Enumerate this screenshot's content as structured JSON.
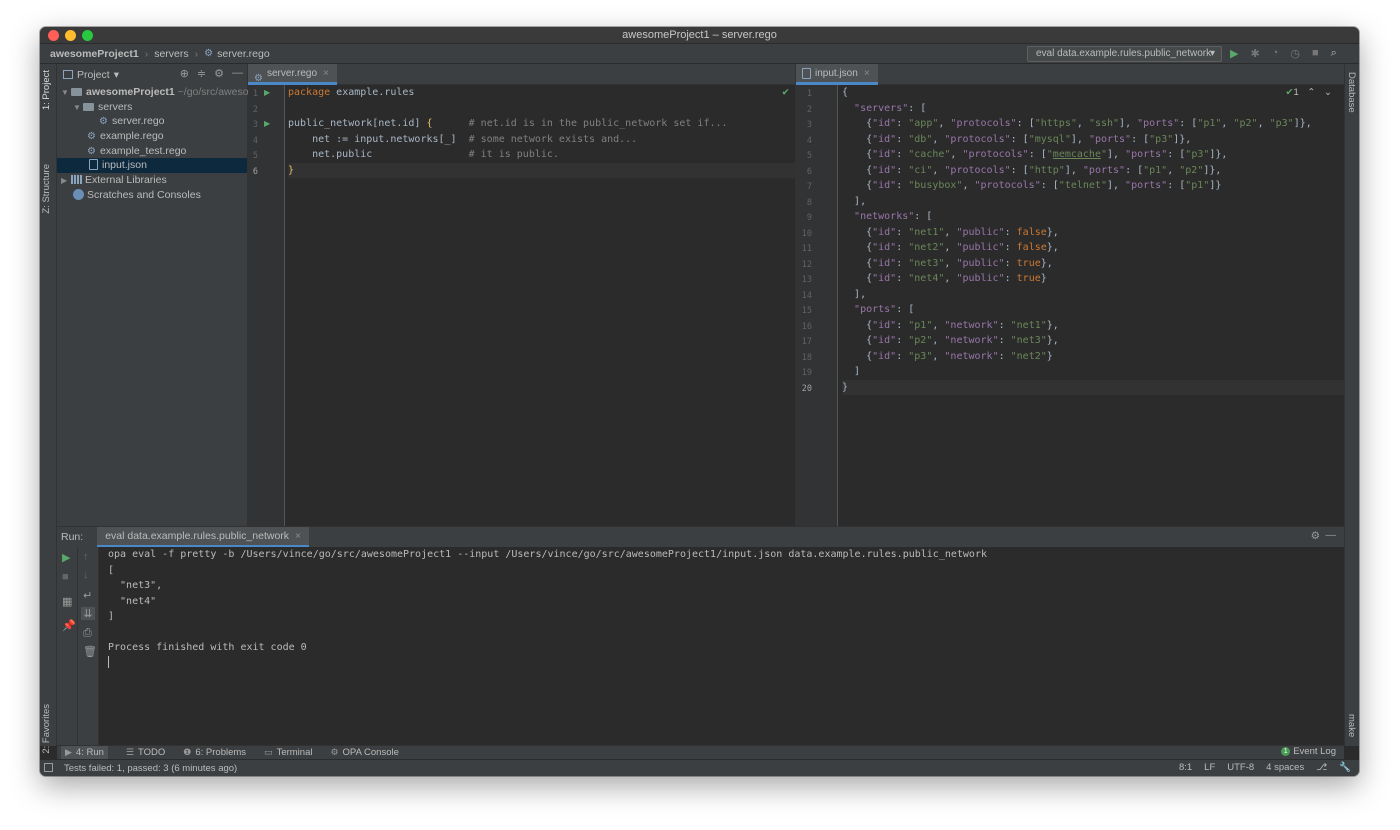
{
  "window": {
    "title": "awesomeProject1 – server.rego"
  },
  "breadcrumb": {
    "project": "awesomeProject1",
    "folder": "servers",
    "file": "server.rego"
  },
  "run_config": {
    "label": "eval data.example.rules.public_network"
  },
  "left_strip": {
    "project_tab": "1: Project",
    "structure_tab": "Z: Structure",
    "favorites_tab": "2: Favorites"
  },
  "right_strip": {
    "database_tab": "Database",
    "make_tab": "make"
  },
  "project_panel": {
    "title": "Project",
    "root": "awesomeProject1",
    "root_path": "~/go/src/aweso",
    "servers": "servers",
    "server_rego": "server.rego",
    "example_rego": "example.rego",
    "example_test": "example_test.rego",
    "input_json": "input.json",
    "external": "External Libraries",
    "scratches": "Scratches and Consoles"
  },
  "left_editor": {
    "tab": "server.rego",
    "line_numbers": [
      "1",
      "2",
      "3",
      "4",
      "5",
      "6"
    ],
    "lines": {
      "l1_kw": "package",
      "l1_rest": " example.rules",
      "l3_a": "public_network[net.id] ",
      "l3_brace": "{",
      "l3_cmt": "      # net.id is in the public_network set if...",
      "l4_a": "    net := input.networks[_]  ",
      "l4_cmt": "# some network exists and...",
      "l5_a": "    net.public                ",
      "l5_cmt": "# it is public.",
      "l6_brace": "}"
    }
  },
  "right_editor": {
    "tab": "input.json",
    "inspection_count": "1",
    "line_numbers": [
      "1",
      "2",
      "3",
      "4",
      "5",
      "6",
      "7",
      "8",
      "9",
      "10",
      "11",
      "12",
      "13",
      "14",
      "15",
      "16",
      "17",
      "18",
      "19",
      "20"
    ],
    "tok": {
      "open": "{",
      "close": "}",
      "ob": "[",
      "cb": "]",
      "cbc": "],",
      "lbrace": "{",
      "rbrace": "}",
      "rbrace_c": "},",
      "rbbr_c": "]},",
      "rbbr": "]}",
      "colon": ": ",
      "comma": ", ",
      "colon_ob": ": [",
      "servers": "\"servers\"",
      "networks": "\"networks\"",
      "ports_key": "\"ports\"",
      "id": "\"id\"",
      "protocols": "\"protocols\"",
      "ports": "\"ports\"",
      "public": "\"public\"",
      "network": "\"network\"",
      "app": "\"app\"",
      "db": "\"db\"",
      "cache_open": "\"",
      "cache_word": "memcache",
      "cache": "\"cache\"",
      "ci": "\"ci\"",
      "busybox": "\"busybox\"",
      "https": "\"https\"",
      "ssh": "\"ssh\"",
      "mysql": "\"mysql\"",
      "http": "\"http\"",
      "telnet": "\"telnet\"",
      "p1": "\"p1\"",
      "p2": "\"p2\"",
      "p3": "\"p3\"",
      "net1": "\"net1\"",
      "net2": "\"net2\"",
      "net3": "\"net3\"",
      "net4": "\"net4\"",
      "false": "false",
      "true": "true"
    }
  },
  "run_panel": {
    "label": "Run:",
    "tab": "eval data.example.rules.public_network",
    "console": [
      "opa eval -f pretty -b /Users/vince/go/src/awesomeProject1 --input /Users/vince/go/src/awesomeProject1/input.json data.example.rules.public_network",
      "[",
      "  \"net3\",",
      "  \"net4\"",
      "]",
      "",
      "Process finished with exit code 0"
    ]
  },
  "bottom_toolbar": {
    "run": "4: Run",
    "todo": "TODO",
    "problems": "6: Problems",
    "terminal": "Terminal",
    "opa": "OPA Console",
    "event_log": "Event Log",
    "event_count": "1"
  },
  "status": {
    "message": "Tests failed: 1, passed: 3 (6 minutes ago)",
    "position": "8:1",
    "line_sep": "LF",
    "encoding": "UTF-8",
    "indent": "4 spaces"
  },
  "colors": {
    "accent": "#4a88c7",
    "run_green": "#59a869",
    "keyword": "#cc7832",
    "string": "#6a8759",
    "key": "#9876aa"
  }
}
